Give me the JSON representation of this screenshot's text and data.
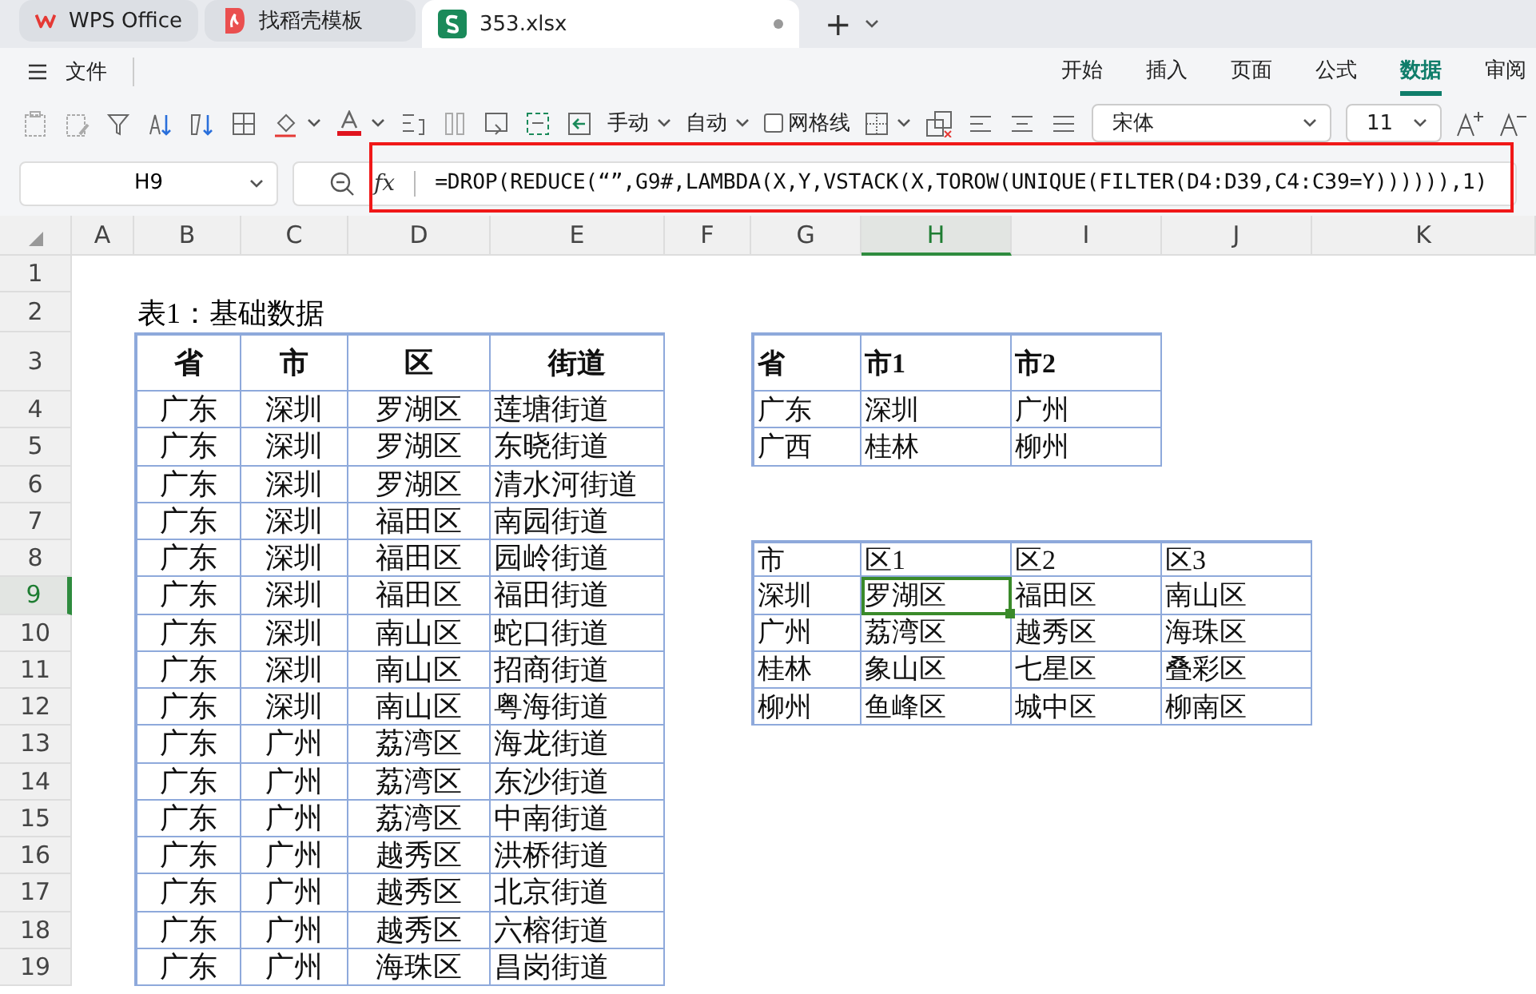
{
  "tabs": [
    {
      "kind": "home",
      "label": "WPS Office",
      "selected": false
    },
    {
      "kind": "template",
      "label": "找稻壳模板",
      "selected": false
    },
    {
      "kind": "sheet",
      "label": "353.xlsx",
      "selected": true
    }
  ],
  "new_tab": "+",
  "file_menu": "文件",
  "ribbon_tabs": [
    {
      "label": "开始",
      "selected": false
    },
    {
      "label": "插入",
      "selected": false
    },
    {
      "label": "页面",
      "selected": false
    },
    {
      "label": "公式",
      "selected": false
    },
    {
      "label": "数据",
      "selected": true
    },
    {
      "label": "审阅",
      "selected": false
    }
  ],
  "toolbar": {
    "wrap_manual": "手动",
    "wrap_auto": "自动",
    "gridlines": {
      "label": "网格线",
      "checked": false
    },
    "font": "宋体",
    "font_size": "11"
  },
  "formula_bar": {
    "cell": "H9",
    "function_label": "fx",
    "formula": "=DROP(REDUCE(“”,G9#,LAMBDA(X,Y,VSTACK(X,TOROW(UNIQUE(FILTER(D4:D39,C4:C39=Y)))))),1)"
  },
  "columns": [
    {
      "label": "A",
      "selected": false
    },
    {
      "label": "B",
      "selected": false
    },
    {
      "label": "C",
      "selected": false
    },
    {
      "label": "D",
      "selected": false
    },
    {
      "label": "E",
      "selected": false
    },
    {
      "label": "F",
      "selected": false
    },
    {
      "label": "G",
      "selected": false
    },
    {
      "label": "H",
      "selected": true
    },
    {
      "label": "I",
      "selected": false
    },
    {
      "label": "J",
      "selected": false
    },
    {
      "label": "K",
      "selected": false
    }
  ],
  "rows": [
    {
      "label": "1",
      "selected": false
    },
    {
      "label": "2",
      "selected": false
    },
    {
      "label": "3",
      "selected": false
    },
    {
      "label": "4",
      "selected": false
    },
    {
      "label": "5",
      "selected": false
    },
    {
      "label": "6",
      "selected": false
    },
    {
      "label": "7",
      "selected": false
    },
    {
      "label": "8",
      "selected": false
    },
    {
      "label": "9",
      "selected": true
    },
    {
      "label": "10",
      "selected": false
    },
    {
      "label": "11",
      "selected": false
    },
    {
      "label": "12",
      "selected": false
    },
    {
      "label": "13",
      "selected": false
    },
    {
      "label": "14",
      "selected": false
    },
    {
      "label": "15",
      "selected": false
    },
    {
      "label": "16",
      "selected": false
    },
    {
      "label": "17",
      "selected": false
    },
    {
      "label": "18",
      "selected": false
    },
    {
      "label": "19",
      "selected": false
    }
  ],
  "table1": {
    "title": "表1：基础数据",
    "columns": [
      "省",
      "市",
      "区",
      "街道"
    ],
    "rows": [
      [
        "广东",
        "深圳",
        "罗湖区",
        "莲塘街道"
      ],
      [
        "广东",
        "深圳",
        "罗湖区",
        "东晓街道"
      ],
      [
        "广东",
        "深圳",
        "罗湖区",
        "清水河街道"
      ],
      [
        "广东",
        "深圳",
        "福田区",
        "南园街道"
      ],
      [
        "广东",
        "深圳",
        "福田区",
        "园岭街道"
      ],
      [
        "广东",
        "深圳",
        "福田区",
        "福田街道"
      ],
      [
        "广东",
        "深圳",
        "南山区",
        "蛇口街道"
      ],
      [
        "广东",
        "深圳",
        "南山区",
        "招商街道"
      ],
      [
        "广东",
        "深圳",
        "南山区",
        "粤海街道"
      ],
      [
        "广东",
        "广州",
        "荔湾区",
        "海龙街道"
      ],
      [
        "广东",
        "广州",
        "荔湾区",
        "东沙街道"
      ],
      [
        "广东",
        "广州",
        "荔湾区",
        "中南街道"
      ],
      [
        "广东",
        "广州",
        "越秀区",
        "洪桥街道"
      ],
      [
        "广东",
        "广州",
        "越秀区",
        "北京街道"
      ],
      [
        "广东",
        "广州",
        "越秀区",
        "六榕街道"
      ],
      [
        "广东",
        "广州",
        "海珠区",
        "昌岗街道"
      ]
    ]
  },
  "table2": {
    "columns": [
      "省",
      "市1",
      "市2"
    ],
    "rows": [
      [
        "广东",
        "深圳",
        "广州"
      ],
      [
        "广西",
        "桂林",
        "柳州"
      ]
    ]
  },
  "table3": {
    "columns": [
      "市",
      "区1",
      "区2",
      "区3"
    ],
    "rows": [
      [
        {
          "text": "深圳",
          "selected": false
        },
        {
          "text": "罗湖区",
          "selected": true
        },
        {
          "text": "福田区",
          "selected": false
        },
        {
          "text": "南山区",
          "selected": false
        }
      ],
      [
        {
          "text": "广州",
          "selected": false
        },
        {
          "text": "荔湾区",
          "selected": false
        },
        {
          "text": "越秀区",
          "selected": false
        },
        {
          "text": "海珠区",
          "selected": false
        }
      ],
      [
        {
          "text": "桂林",
          "selected": false
        },
        {
          "text": "象山区",
          "selected": false
        },
        {
          "text": "七星区",
          "selected": false
        },
        {
          "text": "叠彩区",
          "selected": false
        }
      ],
      [
        {
          "text": "柳州",
          "selected": false
        },
        {
          "text": "鱼峰区",
          "selected": false
        },
        {
          "text": "城中区",
          "selected": false
        },
        {
          "text": "柳南区",
          "selected": false
        }
      ]
    ]
  }
}
